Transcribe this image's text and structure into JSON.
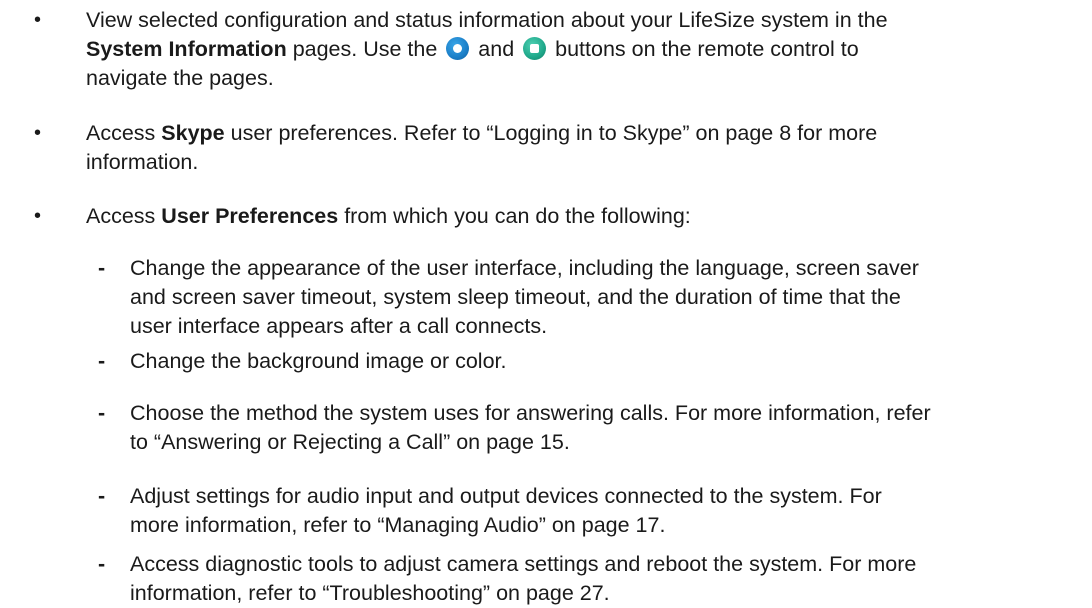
{
  "list": {
    "item1": {
      "marker": "•",
      "text_a": "View selected configuration and status information about your LifeSize system in the",
      "bold": "System Information",
      "text_b": "pages. Use the",
      "button1_icon": "blue-circle-button-icon",
      "text_c": "and",
      "button2_icon": "green-square-button-icon",
      "text_d": "buttons on the remote control to",
      "text_e": "navigate the pages."
    },
    "item2": {
      "marker": "•",
      "text_a": "Access",
      "bold": "Skype",
      "text_b": "user preferences. Refer to “Logging in to Skype” on page 8 for more",
      "text_c": "information."
    },
    "item3": {
      "marker": "•",
      "text_a": "Access",
      "bold": "User Preferences",
      "text_b": "from which you can do the following:"
    },
    "subitems": [
      {
        "marker": "-",
        "line1": "Change the appearance of the user interface, including the language, screen saver",
        "line2": "and screen saver timeout, system sleep timeout, and the duration of time that the",
        "line3": "user interface appears after a call connects."
      },
      {
        "marker": "-",
        "line1": "Change the background image or color."
      },
      {
        "marker": "-",
        "line1": "Choose the method the system uses for answering calls. For more information, refer",
        "line2": "to “Answering or Rejecting a Call” on page 15."
      },
      {
        "marker": "-",
        "line1": "Adjust settings for audio input and output devices connected to the system. For",
        "line2": "more information, refer to “Managing Audio” on page 17."
      },
      {
        "marker": "-",
        "line1": "Access diagnostic tools to adjust camera settings and reboot the system. For more",
        "line2": "information, refer to “Troubleshooting” on page 27."
      }
    ]
  },
  "colors": {
    "text": "#1a1a1a",
    "blue_button": "#1b7fc8",
    "green_button": "#1fa88a"
  }
}
